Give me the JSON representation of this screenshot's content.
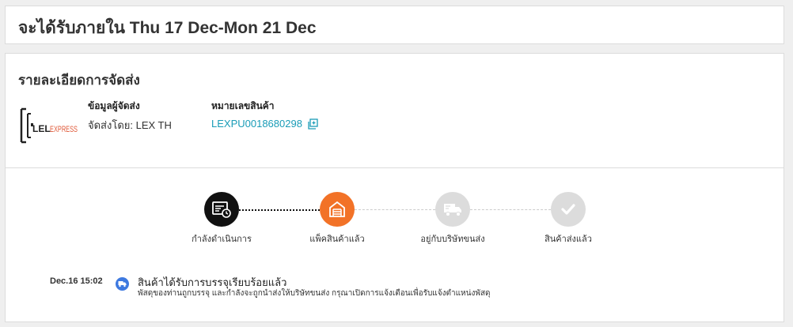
{
  "eta": {
    "title": "จะได้รับภายใน Thu 17 Dec-Mon 21 Dec"
  },
  "shipping": {
    "section_title": "รายละเอียดการจัดส่ง",
    "logo_text_lel": "LEL",
    "logo_text_express": "EXPRESS",
    "carrier_label": "ข้อมูลผู้จัดส่ง",
    "carrier_value": "จัดส่งโดย: LEX TH",
    "tracking_label": "หมายเลขสินค้า",
    "tracking_number": "LEXPU0018680298"
  },
  "progress": {
    "steps": [
      {
        "label": "กำลังดำเนินการ",
        "state": "done",
        "icon": "processing-icon"
      },
      {
        "label": "แพ็คสินค้าแล้ว",
        "state": "current",
        "icon": "warehouse-icon"
      },
      {
        "label": "อยู่กับบริษัทขนส่ง",
        "state": "pending",
        "icon": "truck-icon"
      },
      {
        "label": "สินค้าส่งแล้ว",
        "state": "pending",
        "icon": "check-icon"
      }
    ]
  },
  "events": [
    {
      "time": "Dec.16 15:02",
      "title": "สินค้าได้รับการบรรจุเรียบร้อยแล้ว",
      "desc": "พัสดุของท่านถูกบรรจุ และกำลังจะถูกนำส่งให้บริษัทขนส่ง กรุณาเปิดการแจ้งเตือนเพื่อรับแจ้งตำแหน่งพัสดุ"
    }
  ],
  "colors": {
    "done": "#111111",
    "current": "#f27227",
    "pending": "#dcdcdc",
    "link": "#1a9cb7",
    "event_icon": "#3d79e0"
  }
}
